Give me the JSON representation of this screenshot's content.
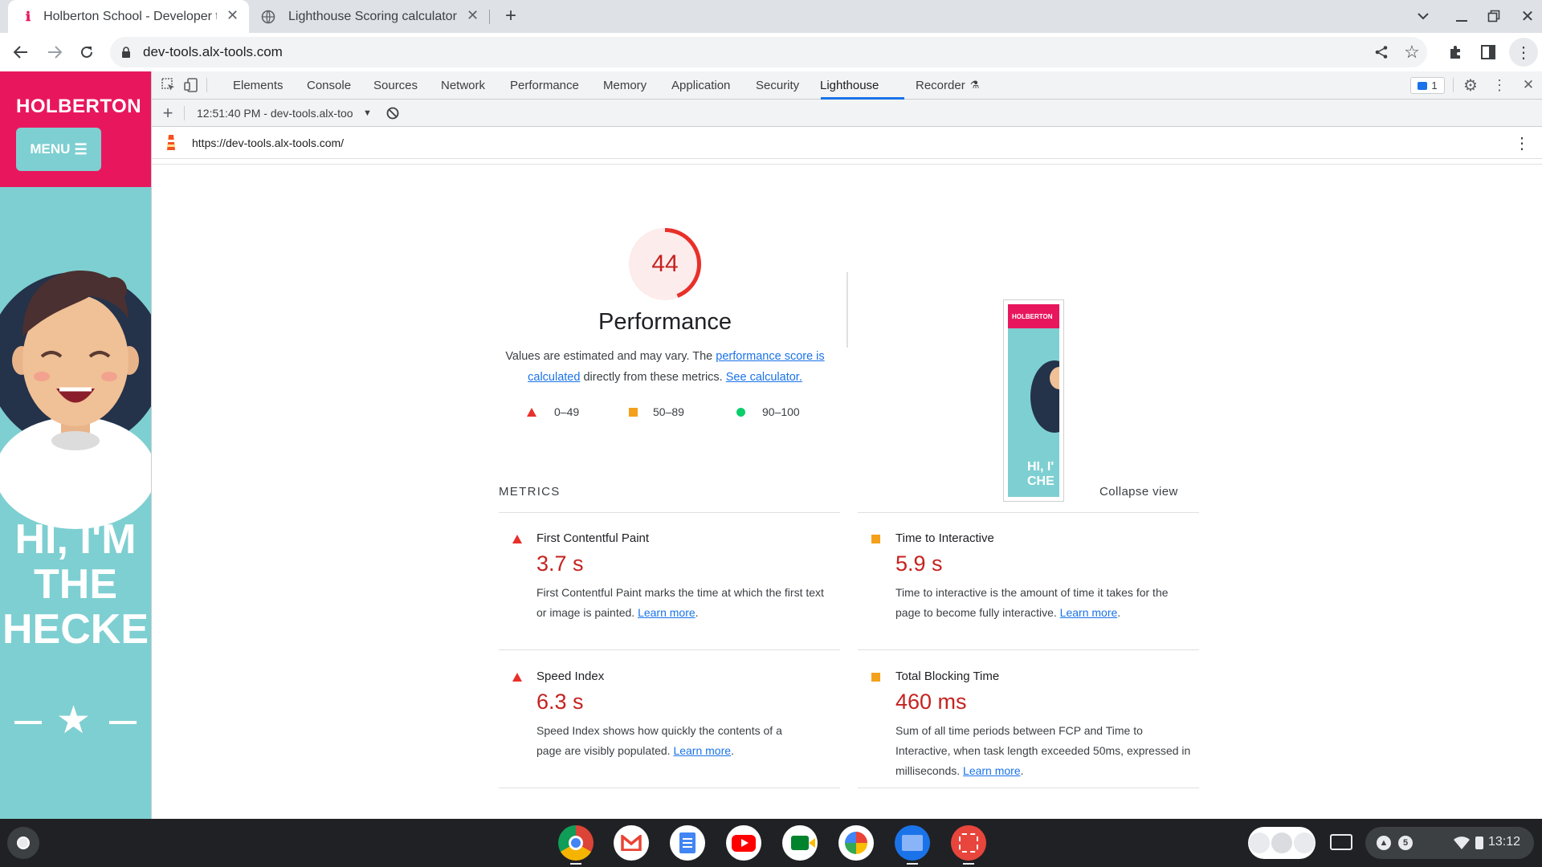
{
  "browser": {
    "tabs": [
      {
        "title": "Holberton School - Developer to",
        "active": true
      },
      {
        "title": "Lighthouse Scoring calculator",
        "active": false
      }
    ],
    "url": "dev-tools.alx-tools.com"
  },
  "page": {
    "logo": "HOLBERTON",
    "menu_label": "MENU",
    "hero_lines": [
      "HI, I'M",
      "THE",
      "HECKE"
    ]
  },
  "devtools": {
    "tabs": [
      "Elements",
      "Console",
      "Sources",
      "Network",
      "Performance",
      "Memory",
      "Application",
      "Security",
      "Lighthouse",
      "Recorder"
    ],
    "active_tab": "Lighthouse",
    "issues_count": "1",
    "report_selector": "12:51:40 PM - dev-tools.alx-too",
    "report_url": "https://dev-tools.alx-tools.com/"
  },
  "report": {
    "score": "44",
    "category": "Performance",
    "desc_prefix": "Values are estimated and may vary. The ",
    "desc_link1": "performance score is calculated",
    "desc_mid": " directly from these metrics. ",
    "desc_link2": "See calculator.",
    "legend": [
      {
        "shape": "triangle",
        "range": "0–49",
        "color": "#e8302a"
      },
      {
        "shape": "square",
        "range": "50–89",
        "color": "#f4a01c"
      },
      {
        "shape": "circle",
        "range": "90–100",
        "color": "#0cce6b"
      }
    ],
    "thumb_logo": "HOLBERTON",
    "thumb_text": [
      "HI, I'",
      "CHE"
    ],
    "metrics_heading": "METRICS",
    "collapse_label": "Collapse view",
    "learn_more": "Learn more",
    "metrics": [
      {
        "name": "First Contentful Paint",
        "value": "3.7 s",
        "status": "fail",
        "desc": "First Contentful Paint marks the time at which the first text or image is painted. "
      },
      {
        "name": "Time to Interactive",
        "value": "5.9 s",
        "status": "average",
        "desc": "Time to interactive is the amount of time it takes for the page to become fully interactive. "
      },
      {
        "name": "Speed Index",
        "value": "6.3 s",
        "status": "fail",
        "desc": "Speed Index shows how quickly the contents of a page are visibly populated. "
      },
      {
        "name": "Total Blocking Time",
        "value": "460 ms",
        "status": "average",
        "desc": "Sum of all time periods between FCP and Time to Interactive, when task length exceeded 50ms, expressed in milliseconds. "
      }
    ]
  },
  "shelf": {
    "apps": [
      "Chrome",
      "Gmail",
      "Docs",
      "YouTube",
      "Meet",
      "Photos",
      "Files",
      "Screencast"
    ],
    "notification_count": "5",
    "time": "13:12"
  },
  "colors": {
    "fail": "#e8302a",
    "average": "#f4a01c",
    "pass": "#0cce6b",
    "brand_pink": "#e8175d",
    "brand_teal": "#7ecfd1"
  }
}
